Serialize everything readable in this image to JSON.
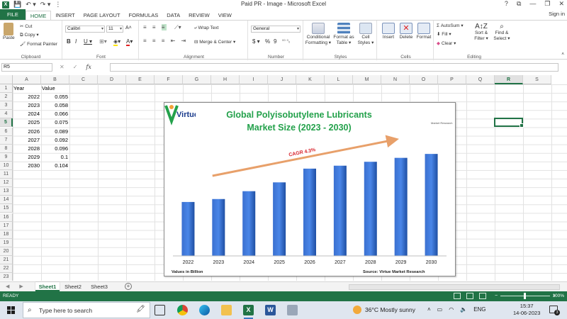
{
  "window": {
    "title": "Paid PR - Image - Microsoft Excel",
    "controls": [
      "?",
      "⧉",
      "—",
      "❐",
      "✕"
    ]
  },
  "ribbon_tabs": [
    "FILE",
    "HOME",
    "INSERT",
    "PAGE LAYOUT",
    "FORMULAS",
    "DATA",
    "REVIEW",
    "VIEW"
  ],
  "active_tab": "HOME",
  "sign_in": "Sign in",
  "clipboard": {
    "paste": "Paste",
    "cut": "Cut",
    "copy": "Copy ▾",
    "format_painter": "Format Painter",
    "label": "Clipboard"
  },
  "font": {
    "name": "Calibri",
    "size": "11",
    "grow": "A˄",
    "shrink": "A˅",
    "bold": "B",
    "italic": "I",
    "underline": "U ▾",
    "label": "Font"
  },
  "alignment": {
    "wrap_text": "Wrap Text",
    "merge_center": "Merge & Center ▾",
    "label": "Alignment"
  },
  "number": {
    "format": "General",
    "currency": "$ ▾",
    "percent": "%",
    "comma": "9",
    "label": "Number"
  },
  "styles": {
    "conditional": "Conditional\nFormatting ▾",
    "conditional_1": "Conditional",
    "conditional_2": "Formatting ▾",
    "format_table_1": "Format as",
    "format_table_2": "Table ▾",
    "cell_styles_1": "Cell",
    "cell_styles_2": "Styles ▾",
    "label": "Styles"
  },
  "cells": {
    "insert": "Insert",
    "delete": "Delete",
    "format": "Format",
    "label": "Cells"
  },
  "editing": {
    "autosum": "AutoSum ▾",
    "fill": "Fill ▾",
    "clear": "Clear ▾",
    "sort_1": "Sort &",
    "sort_2": "Filter ▾",
    "find_1": "Find &",
    "find_2": "Select ▾",
    "label": "Editing"
  },
  "formula_bar": {
    "name_box": "R5",
    "fx": "fx",
    "cancel": "✕",
    "enter": "✓",
    "value": ""
  },
  "columns": [
    "A",
    "B",
    "C",
    "D",
    "E",
    "F",
    "G",
    "H",
    "I",
    "J",
    "K",
    "L",
    "M",
    "N",
    "O",
    "P",
    "Q",
    "R",
    "S"
  ],
  "selected_column": "R",
  "rows": [
    "1",
    "2",
    "3",
    "4",
    "5",
    "6",
    "7",
    "8",
    "9",
    "10",
    "11",
    "12",
    "13",
    "14",
    "15",
    "16",
    "17",
    "18",
    "19",
    "20",
    "21",
    "22",
    "23"
  ],
  "selected_row": "5",
  "sheet_data": {
    "header": [
      "Year",
      "Value"
    ],
    "years": [
      "2022",
      "2023",
      "2024",
      "2025",
      "2026",
      "2027",
      "2028",
      "2029",
      "2030"
    ],
    "values": [
      "0.055",
      "0.058",
      "0.066",
      "0.075",
      "0.089",
      "0.092",
      "0.096",
      "0.1",
      "0.104"
    ]
  },
  "chart_data": {
    "type": "bar",
    "title_line1": "Global Polyisobutylene Lubricants",
    "title_line2": "Market Size  (2023 - 2030)",
    "categories": [
      "2022",
      "2023",
      "2024",
      "2025",
      "2026",
      "2027",
      "2028",
      "2029",
      "2030"
    ],
    "values": [
      0.055,
      0.058,
      0.066,
      0.075,
      0.089,
      0.092,
      0.096,
      0.1,
      0.104
    ],
    "annotation": "CAGR 4.3%",
    "footnote_left": "Values in Billion",
    "footnote_right": "Source: Virtue Market Research",
    "logo_text": "Virtue",
    "logo_subtext": "Market Research",
    "bar_color": "#2a64c5",
    "title_color": "#23a14b",
    "arrow_color": "#e8a06a",
    "annotation_color": "#d8242d",
    "ylim": [
      0,
      0.12
    ],
    "grid": false,
    "legend": "none"
  },
  "sheets": [
    "Sheet1",
    "Sheet2",
    "Sheet3"
  ],
  "active_sheet": "Sheet1",
  "status": {
    "ready": "READY",
    "zoom": "100%"
  },
  "taskbar": {
    "search_placeholder": "Type here to search",
    "weather": "36°C  Mostly sunny",
    "language": "ENG",
    "time": "15:37",
    "date": "14-06-2023",
    "notifications": "3"
  },
  "colors": {
    "excel_green": "#217346",
    "taskbar": "#dfe6ef"
  }
}
